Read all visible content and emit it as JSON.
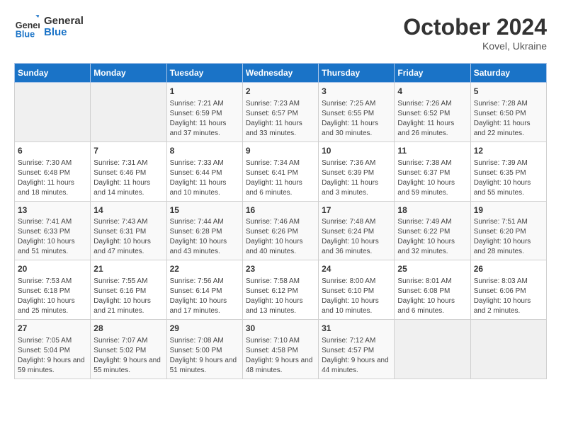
{
  "logo": {
    "line1": "General",
    "line2": "Blue"
  },
  "title": "October 2024",
  "subtitle": "Kovel, Ukraine",
  "days_of_week": [
    "Sunday",
    "Monday",
    "Tuesday",
    "Wednesday",
    "Thursday",
    "Friday",
    "Saturday"
  ],
  "weeks": [
    [
      {
        "day": "",
        "empty": true
      },
      {
        "day": "",
        "empty": true
      },
      {
        "day": "1",
        "sunrise": "7:21 AM",
        "sunset": "6:59 PM",
        "daylight": "11 hours and 37 minutes."
      },
      {
        "day": "2",
        "sunrise": "7:23 AM",
        "sunset": "6:57 PM",
        "daylight": "11 hours and 33 minutes."
      },
      {
        "day": "3",
        "sunrise": "7:25 AM",
        "sunset": "6:55 PM",
        "daylight": "11 hours and 30 minutes."
      },
      {
        "day": "4",
        "sunrise": "7:26 AM",
        "sunset": "6:52 PM",
        "daylight": "11 hours and 26 minutes."
      },
      {
        "day": "5",
        "sunrise": "7:28 AM",
        "sunset": "6:50 PM",
        "daylight": "11 hours and 22 minutes."
      }
    ],
    [
      {
        "day": "6",
        "sunrise": "7:30 AM",
        "sunset": "6:48 PM",
        "daylight": "11 hours and 18 minutes."
      },
      {
        "day": "7",
        "sunrise": "7:31 AM",
        "sunset": "6:46 PM",
        "daylight": "11 hours and 14 minutes."
      },
      {
        "day": "8",
        "sunrise": "7:33 AM",
        "sunset": "6:44 PM",
        "daylight": "11 hours and 10 minutes."
      },
      {
        "day": "9",
        "sunrise": "7:34 AM",
        "sunset": "6:41 PM",
        "daylight": "11 hours and 6 minutes."
      },
      {
        "day": "10",
        "sunrise": "7:36 AM",
        "sunset": "6:39 PM",
        "daylight": "11 hours and 3 minutes."
      },
      {
        "day": "11",
        "sunrise": "7:38 AM",
        "sunset": "6:37 PM",
        "daylight": "10 hours and 59 minutes."
      },
      {
        "day": "12",
        "sunrise": "7:39 AM",
        "sunset": "6:35 PM",
        "daylight": "10 hours and 55 minutes."
      }
    ],
    [
      {
        "day": "13",
        "sunrise": "7:41 AM",
        "sunset": "6:33 PM",
        "daylight": "10 hours and 51 minutes."
      },
      {
        "day": "14",
        "sunrise": "7:43 AM",
        "sunset": "6:31 PM",
        "daylight": "10 hours and 47 minutes."
      },
      {
        "day": "15",
        "sunrise": "7:44 AM",
        "sunset": "6:28 PM",
        "daylight": "10 hours and 43 minutes."
      },
      {
        "day": "16",
        "sunrise": "7:46 AM",
        "sunset": "6:26 PM",
        "daylight": "10 hours and 40 minutes."
      },
      {
        "day": "17",
        "sunrise": "7:48 AM",
        "sunset": "6:24 PM",
        "daylight": "10 hours and 36 minutes."
      },
      {
        "day": "18",
        "sunrise": "7:49 AM",
        "sunset": "6:22 PM",
        "daylight": "10 hours and 32 minutes."
      },
      {
        "day": "19",
        "sunrise": "7:51 AM",
        "sunset": "6:20 PM",
        "daylight": "10 hours and 28 minutes."
      }
    ],
    [
      {
        "day": "20",
        "sunrise": "7:53 AM",
        "sunset": "6:18 PM",
        "daylight": "10 hours and 25 minutes."
      },
      {
        "day": "21",
        "sunrise": "7:55 AM",
        "sunset": "6:16 PM",
        "daylight": "10 hours and 21 minutes."
      },
      {
        "day": "22",
        "sunrise": "7:56 AM",
        "sunset": "6:14 PM",
        "daylight": "10 hours and 17 minutes."
      },
      {
        "day": "23",
        "sunrise": "7:58 AM",
        "sunset": "6:12 PM",
        "daylight": "10 hours and 13 minutes."
      },
      {
        "day": "24",
        "sunrise": "8:00 AM",
        "sunset": "6:10 PM",
        "daylight": "10 hours and 10 minutes."
      },
      {
        "day": "25",
        "sunrise": "8:01 AM",
        "sunset": "6:08 PM",
        "daylight": "10 hours and 6 minutes."
      },
      {
        "day": "26",
        "sunrise": "8:03 AM",
        "sunset": "6:06 PM",
        "daylight": "10 hours and 2 minutes."
      }
    ],
    [
      {
        "day": "27",
        "sunrise": "7:05 AM",
        "sunset": "5:04 PM",
        "daylight": "9 hours and 59 minutes."
      },
      {
        "day": "28",
        "sunrise": "7:07 AM",
        "sunset": "5:02 PM",
        "daylight": "9 hours and 55 minutes."
      },
      {
        "day": "29",
        "sunrise": "7:08 AM",
        "sunset": "5:00 PM",
        "daylight": "9 hours and 51 minutes."
      },
      {
        "day": "30",
        "sunrise": "7:10 AM",
        "sunset": "4:58 PM",
        "daylight": "9 hours and 48 minutes."
      },
      {
        "day": "31",
        "sunrise": "7:12 AM",
        "sunset": "4:57 PM",
        "daylight": "9 hours and 44 minutes."
      },
      {
        "day": "",
        "empty": true
      },
      {
        "day": "",
        "empty": true
      }
    ]
  ]
}
